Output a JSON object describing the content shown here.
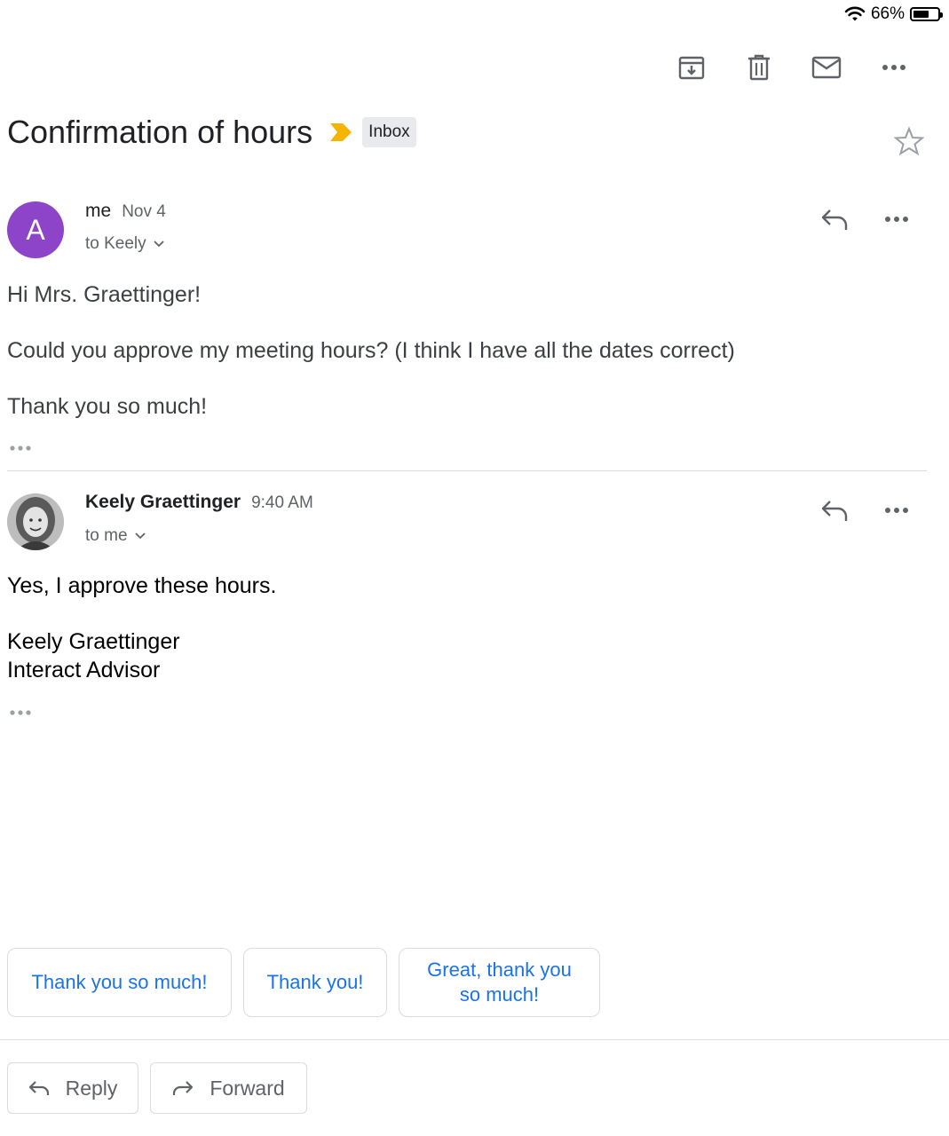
{
  "status_bar": {
    "battery_text": "66%",
    "battery_level": 0.66
  },
  "toolbar": {
    "archive_icon": "archive-icon",
    "delete_icon": "trash-icon",
    "mark_unread_icon": "mail-icon",
    "more_icon": "more-icon"
  },
  "subject": {
    "title": "Confirmation of hours",
    "label": "Inbox",
    "importance_color": "#f4b400"
  },
  "messages": [
    {
      "avatar_letter": "A",
      "avatar_color": "#8e44c8",
      "sender": "me",
      "date": "Nov 4",
      "to": "to Keely",
      "body": [
        "Hi Mrs. Graettinger!",
        "Could you approve my meeting hours? (I think I have all the dates correct)",
        "Thank you so much!"
      ]
    },
    {
      "sender": "Keely Graettinger",
      "date": "9:40 AM",
      "to": "to me",
      "body": [
        "Yes, I approve these hours.",
        "Keely Graettinger",
        "Interact Advisor"
      ]
    }
  ],
  "smart_replies": [
    "Thank you so much!",
    "Thank you!",
    "Great, thank you so much!"
  ],
  "actions": {
    "reply": "Reply",
    "forward": "Forward"
  },
  "colors": {
    "accent": "#1a73e8"
  }
}
